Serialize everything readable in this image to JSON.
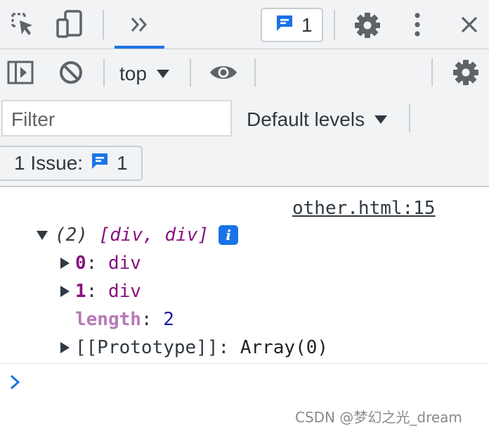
{
  "toolbar": {
    "issues_badge_count": "1",
    "context": "top",
    "more_tabs_label": "»"
  },
  "filter": {
    "placeholder": "Filter",
    "levels_label": "Default levels"
  },
  "issue_bar": {
    "label": "1 Issue:",
    "count": "1"
  },
  "console": {
    "source_link": "other.html:15",
    "summary_count": "(2)",
    "summary_items": "[div, div]",
    "info_badge": "i",
    "entries": [
      {
        "key": "0",
        "value": "div"
      },
      {
        "key": "1",
        "value": "div"
      }
    ],
    "length_key": "length",
    "length_value": "2",
    "prototype_key": "[[Prototype]]",
    "prototype_value": "Array(0)"
  },
  "watermark": "CSDN @梦幻之光_dream",
  "colors": {
    "accent": "#1a73e8",
    "toolbar_bg": "#f1f3f4",
    "key_purple": "#881280",
    "number_blue": "#1a1aa6"
  },
  "icons": [
    "inspect-icon",
    "device-toolbar-icon",
    "more-tabs-icon",
    "issues-icon",
    "settings-icon",
    "kebab-menu-icon",
    "close-icon",
    "sidebar-toggle-icon",
    "clear-console-icon",
    "eye-icon",
    "console-settings-icon",
    "prompt-chevron-icon"
  ]
}
